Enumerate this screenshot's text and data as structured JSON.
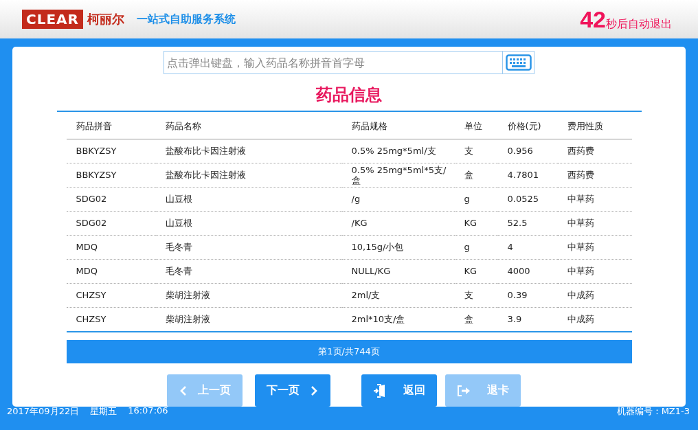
{
  "header": {
    "logo": "CLEAR",
    "brand": "柯丽尔",
    "system_title": "一站式自助服务系统",
    "countdown": "42",
    "countdown_label": "秒后自动退出"
  },
  "search": {
    "placeholder": "点击弹出键盘，输入药品名称拼音首字母"
  },
  "title": "药品信息",
  "table": {
    "columns": [
      "药品拼音",
      "药品名称",
      "药品规格",
      "单位",
      "价格(元)",
      "费用性质"
    ],
    "rows": [
      [
        "BBKYZSY",
        "盐酸布比卡因注射液",
        "0.5% 25mg*5ml/支",
        "支",
        "0.956",
        "西药费"
      ],
      [
        "BBKYZSY",
        "盐酸布比卡因注射液",
        "0.5% 25mg*5ml*5支/盒",
        "盒",
        "4.7801",
        "西药费"
      ],
      [
        "SDG02",
        "山豆根",
        "/g",
        "g",
        "0.0525",
        "中草药"
      ],
      [
        "SDG02",
        "山豆根",
        "/KG",
        "KG",
        "52.5",
        "中草药"
      ],
      [
        "MDQ",
        "毛冬青",
        "10,15g/小包",
        "g",
        "4",
        "中草药"
      ],
      [
        "MDQ",
        "毛冬青",
        "NULL/KG",
        "KG",
        "4000",
        "中草药"
      ],
      [
        "CHZSY",
        "柴胡注射液",
        "2ml/支",
        "支",
        "0.39",
        "中成药"
      ],
      [
        "CHZSY",
        "柴胡注射液",
        "2ml*10支/盒",
        "盒",
        "3.9",
        "中成药"
      ]
    ]
  },
  "pager": "第1页/共744页",
  "buttons": [
    {
      "label": "上一页",
      "kind": "prev",
      "disabled": true
    },
    {
      "label": "下一页",
      "kind": "next",
      "disabled": false
    },
    {
      "label": "返回",
      "kind": "back",
      "disabled": false
    },
    {
      "label": "退卡",
      "kind": "eject",
      "disabled": true
    }
  ],
  "status_bar": {
    "date": "2017年09月22日",
    "weekday": "星期五",
    "time": "16:07:06",
    "machine": "机器编号：MZ1-3"
  }
}
